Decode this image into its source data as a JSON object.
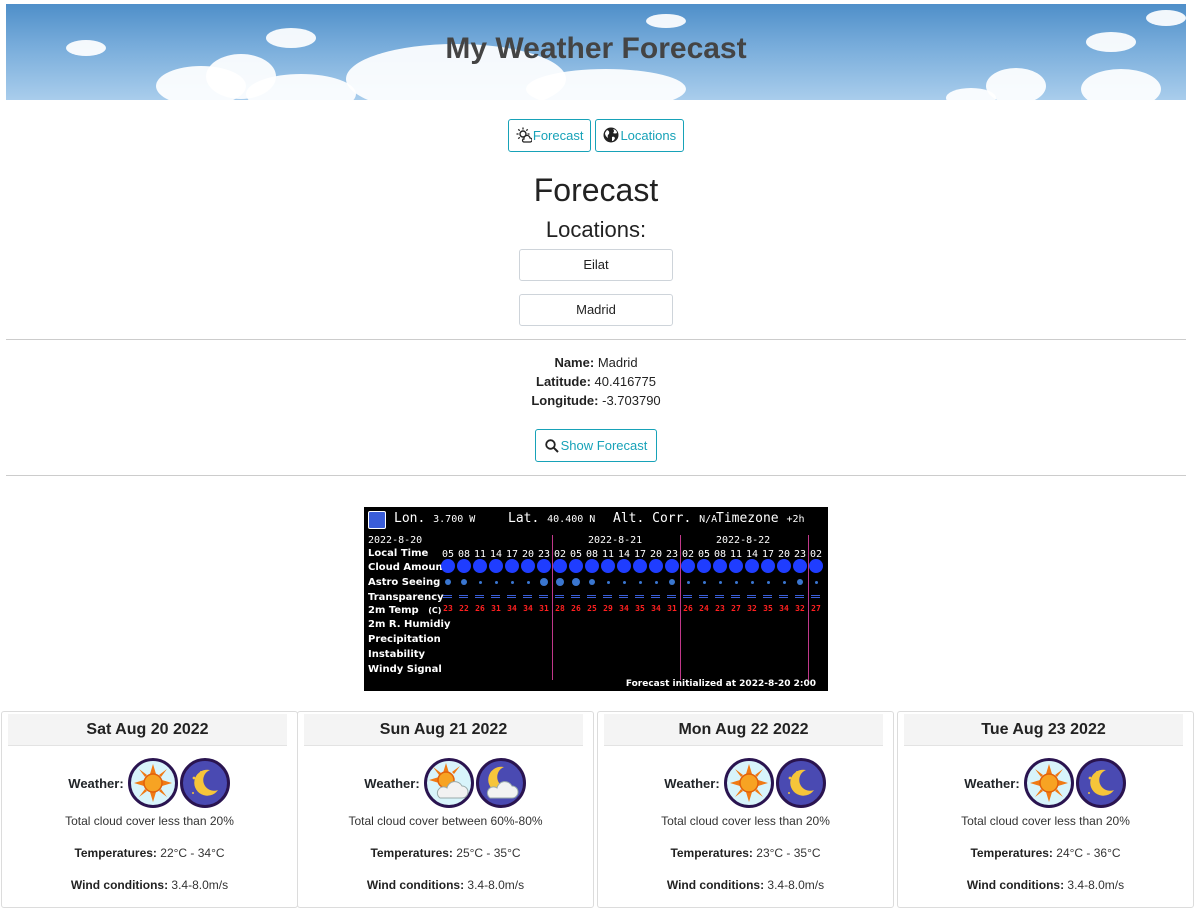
{
  "header": {
    "title": "My Weather Forecast"
  },
  "nav": {
    "forecast_label": "Forecast",
    "locations_label": "Locations"
  },
  "page": {
    "heading": "Forecast",
    "locations_heading": "Locations:"
  },
  "locations": [
    {
      "label": "Eilat"
    },
    {
      "label": "Madrid"
    }
  ],
  "selected": {
    "name_label": "Name:",
    "name": "Madrid",
    "lat_label": "Latitude:",
    "lat": "40.416775",
    "lon_label": "Longitude:",
    "lon": "-3.703790"
  },
  "show_forecast_label": "Show Forecast",
  "astro_chart": {
    "lon_label": "Lon.",
    "lon": "3.700 W",
    "lat_label": "Lat.",
    "lat": "40.400 N",
    "alt_label": "Alt. Corr.",
    "alt": "N/A",
    "tz_label": "Timezone",
    "tz": "+2h",
    "dates": [
      "2022-8-20",
      "2022-8-21",
      "2022-8-22"
    ],
    "rows": [
      "Local Time",
      "Cloud Amount",
      "Astro Seeing",
      "Transparency",
      "2m Temp",
      "2m R. Humidiy",
      "Precipitation",
      "Instability",
      "Windy Signal"
    ],
    "temp_unit": "(C)",
    "hours": [
      "05",
      "08",
      "11",
      "14",
      "17",
      "20",
      "23",
      "02",
      "05",
      "08",
      "11",
      "14",
      "17",
      "20",
      "23",
      "02",
      "05",
      "08",
      "11",
      "14",
      "17",
      "20",
      "23",
      "02"
    ],
    "temps": [
      "23",
      "22",
      "26",
      "31",
      "34",
      "34",
      "31",
      "28",
      "26",
      "25",
      "29",
      "34",
      "35",
      "34",
      "31",
      "26",
      "24",
      "23",
      "27",
      "32",
      "35",
      "34",
      "32",
      "27"
    ],
    "seeing_sizes": [
      2,
      2,
      1,
      1,
      1,
      1,
      3,
      3,
      3,
      2,
      1,
      1,
      1,
      1,
      2,
      1,
      1,
      1,
      1,
      1,
      1,
      1,
      2,
      1
    ],
    "footer": "Forecast initialized at 2022-8-20  2:00"
  },
  "days": [
    {
      "date": "Sat Aug 20 2022",
      "weather_label": "Weather:",
      "day_icon": "sun-icon",
      "night_icon": "moon-stars-icon",
      "desc": "Total cloud cover less than 20%",
      "temp_label": "Temperatures:",
      "temps": "22°C - 34°C",
      "wind_label": "Wind conditions:",
      "wind": "3.4-8.0m/s"
    },
    {
      "date": "Sun Aug 21 2022",
      "weather_label": "Weather:",
      "day_icon": "sun-cloud-icon",
      "night_icon": "moon-cloud-icon",
      "desc": "Total cloud cover between 60%-80%",
      "temp_label": "Temperatures:",
      "temps": "25°C - 35°C",
      "wind_label": "Wind conditions:",
      "wind": "3.4-8.0m/s"
    },
    {
      "date": "Mon Aug 22 2022",
      "weather_label": "Weather:",
      "day_icon": "sun-icon",
      "night_icon": "moon-stars-icon",
      "desc": "Total cloud cover less than 20%",
      "temp_label": "Temperatures:",
      "temps": "23°C - 35°C",
      "wind_label": "Wind conditions:",
      "wind": "3.4-8.0m/s"
    },
    {
      "date": "Tue Aug 23 2022",
      "weather_label": "Weather:",
      "day_icon": "sun-icon",
      "night_icon": "moon-stars-icon",
      "desc": "Total cloud cover less than 20%",
      "temp_label": "Temperatures:",
      "temps": "24°C - 36°C",
      "wind_label": "Wind conditions:",
      "wind": "3.4-8.0m/s"
    }
  ],
  "colors": {
    "accent": "#17a2b8",
    "chart_bg": "#000000",
    "cloud_dot": "#1f3dff",
    "temp": "#ff2020",
    "day_divider": "#c0388a"
  }
}
